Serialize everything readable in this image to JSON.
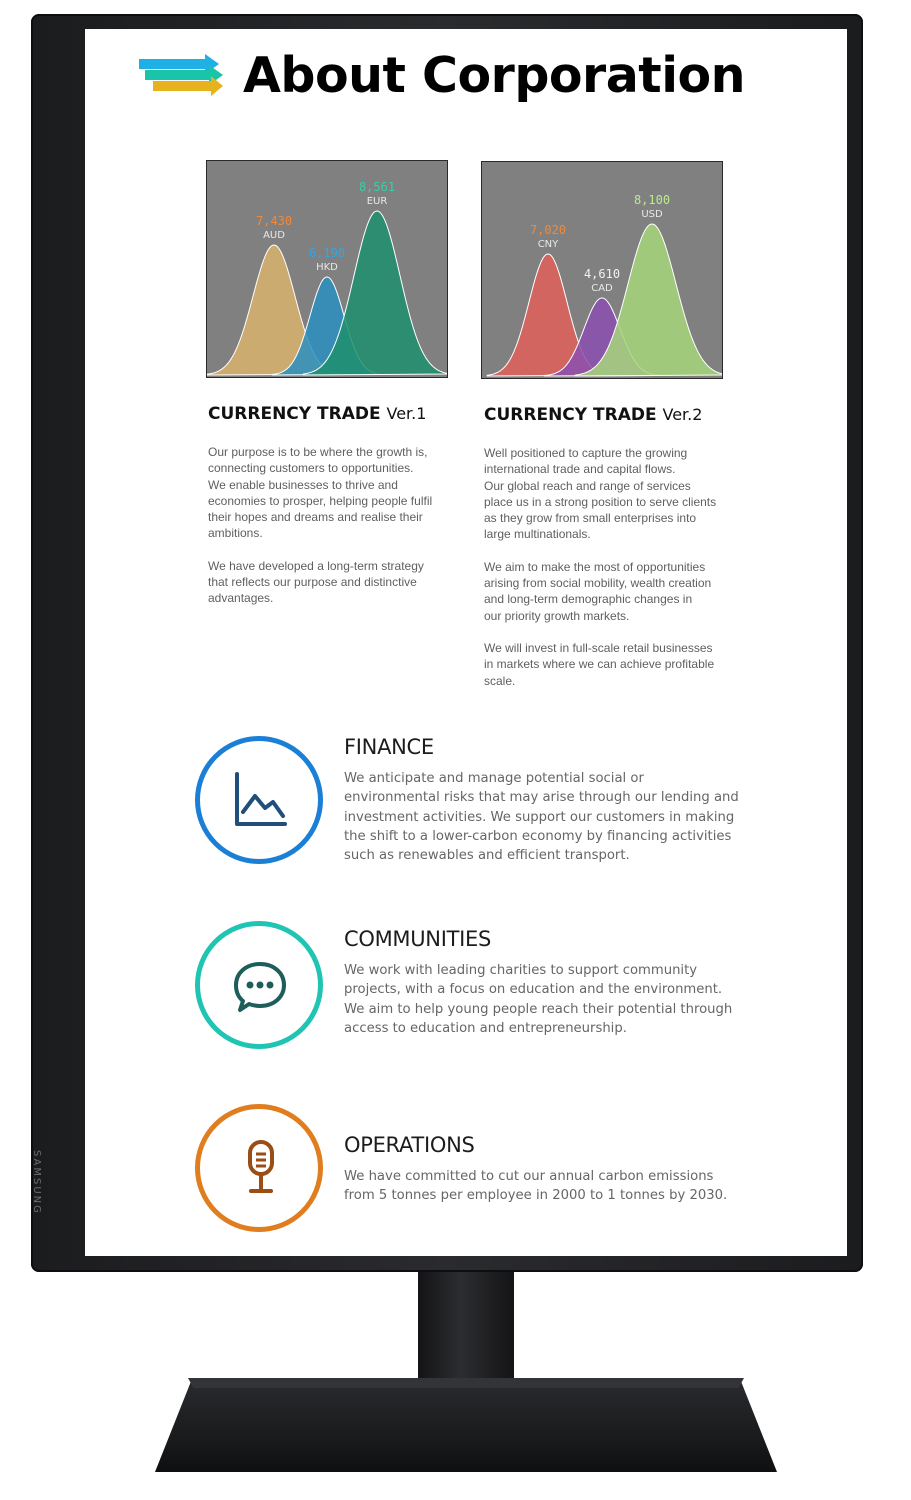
{
  "monitor": {
    "brand": "SAMSUNG"
  },
  "page": {
    "title": "About Corporation"
  },
  "colors": {
    "finance": "#1b7fd6",
    "communities": "#1fc4b2",
    "operations": "#e07d1e"
  },
  "charts": [
    {
      "heading": "CURRENCY TRADE",
      "version": "Ver.1",
      "peaks": [
        {
          "value": "7,430",
          "code": "AUD",
          "color": "#d9b36e",
          "value_color": "#f08a3a"
        },
        {
          "value": "6,190",
          "code": "HKD",
          "color": "#2a8fbf",
          "value_color": "#2fa7e6"
        },
        {
          "value": "8,561",
          "code": "EUR",
          "color": "#1f8f6e",
          "value_color": "#35d0a6"
        }
      ],
      "paragraphs": [
        "Our purpose is to be where the growth is,\nconnecting customers to opportunities.\nWe enable businesses to thrive and\neconomies to prosper, helping people fulfil\ntheir hopes and dreams and realise their\nambitions.",
        "We have developed a long-term strategy\nthat reflects our purpose and distinctive\nadvantages."
      ]
    },
    {
      "heading": "CURRENCY TRADE",
      "version": "Ver.2",
      "peaks": [
        {
          "value": "7,020",
          "code": "CNY",
          "color": "#e0605a",
          "value_color": "#f08a3a"
        },
        {
          "value": "4,610",
          "code": "CAD",
          "color": "#8c4fb0",
          "value_color": "#f2f2f2"
        },
        {
          "value": "8,100",
          "code": "USD",
          "color": "#a6d67a",
          "value_color": "#b9ec8d"
        }
      ],
      "paragraphs": [
        "Well positioned to capture the growing\ninternational trade and capital flows.\nOur global reach and range of services\nplace us in a strong position to serve clients\nas they grow from small enterprises into\nlarge multinationals.",
        "We aim to make the most of opportunities\narising from social mobility, wealth creation\nand long-term demographic changes in\nour priority growth markets.",
        "We will invest in full-scale retail businesses\nin markets where we can achieve profitable\nscale."
      ]
    }
  ],
  "features": [
    {
      "title": "FINANCE",
      "icon": "line-chart-icon",
      "text": "We anticipate and manage potential social or environmental risks that may arise through our lending and investment activities. We support our customers in making the shift to a lower-carbon economy by financing activities such as renewables and efficient transport."
    },
    {
      "title": "COMMUNITIES",
      "icon": "chat-bubble-icon",
      "text": "We work with leading charities to support community projects, with a focus on education and the environment. We aim to help young people reach their potential through access to education and entrepreneurship."
    },
    {
      "title": "OPERATIONS",
      "icon": "microphone-icon",
      "text": "We have committed to cut our annual carbon emissions from 5 tonnes per employee in 2000 to 1 tonnes by 2030."
    }
  ]
}
